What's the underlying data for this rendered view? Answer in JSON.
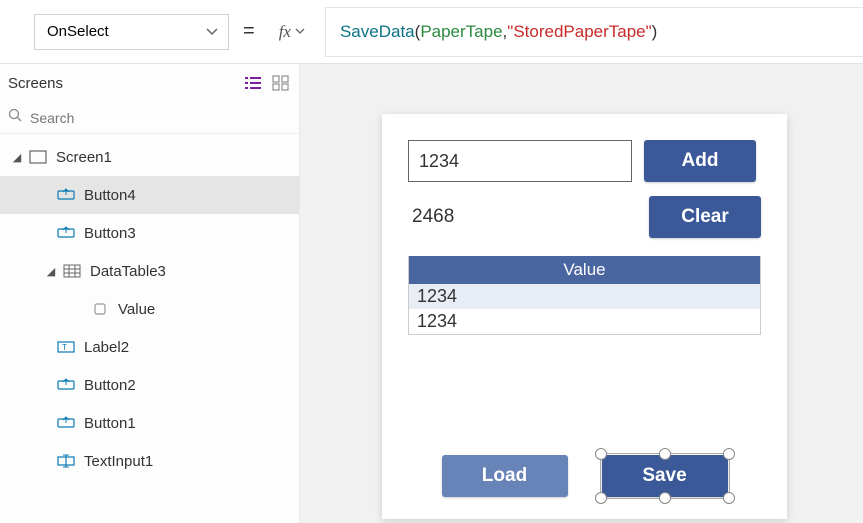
{
  "property_dropdown": {
    "value": "OnSelect"
  },
  "formula": {
    "func": "SaveData",
    "open": "( ",
    "arg1": "PaperTape",
    "comma": ", ",
    "arg2": "\"StoredPaperTape\"",
    "close": " )"
  },
  "tree": {
    "title": "Screens",
    "search_placeholder": "Search",
    "items": [
      {
        "label": "Screen1"
      },
      {
        "label": "Button4"
      },
      {
        "label": "Button3"
      },
      {
        "label": "DataTable3"
      },
      {
        "label": "Value"
      },
      {
        "label": "Label2"
      },
      {
        "label": "Button2"
      },
      {
        "label": "Button1"
      },
      {
        "label": "TextInput1"
      }
    ]
  },
  "app": {
    "text_input_value": "1234",
    "add_label": "Add",
    "clear_label": "Clear",
    "result_label": "2468",
    "table_header": "Value",
    "rows": [
      "1234",
      "1234"
    ],
    "load_label": "Load",
    "save_label": "Save"
  }
}
